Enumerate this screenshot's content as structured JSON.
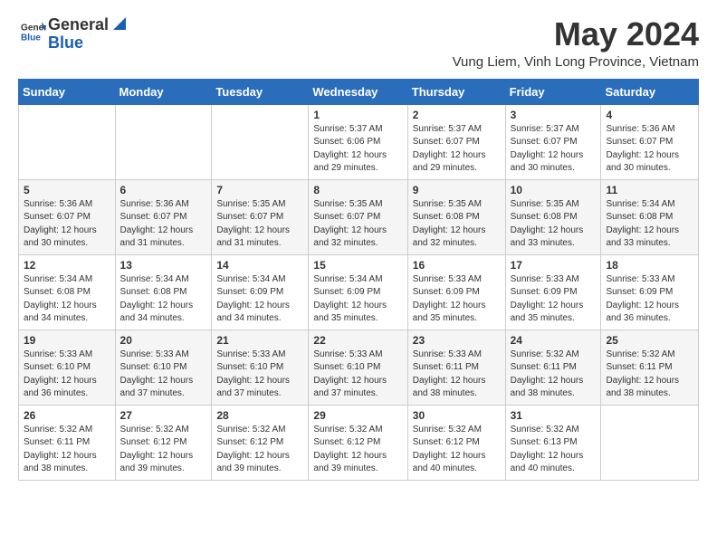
{
  "header": {
    "logo_general": "General",
    "logo_blue": "Blue",
    "month_year": "May 2024",
    "location": "Vung Liem, Vinh Long Province, Vietnam"
  },
  "weekdays": [
    "Sunday",
    "Monday",
    "Tuesday",
    "Wednesday",
    "Thursday",
    "Friday",
    "Saturday"
  ],
  "rows": [
    [
      {
        "day": "",
        "info": ""
      },
      {
        "day": "",
        "info": ""
      },
      {
        "day": "",
        "info": ""
      },
      {
        "day": "1",
        "info": "Sunrise: 5:37 AM\nSunset: 6:06 PM\nDaylight: 12 hours\nand 29 minutes."
      },
      {
        "day": "2",
        "info": "Sunrise: 5:37 AM\nSunset: 6:07 PM\nDaylight: 12 hours\nand 29 minutes."
      },
      {
        "day": "3",
        "info": "Sunrise: 5:37 AM\nSunset: 6:07 PM\nDaylight: 12 hours\nand 30 minutes."
      },
      {
        "day": "4",
        "info": "Sunrise: 5:36 AM\nSunset: 6:07 PM\nDaylight: 12 hours\nand 30 minutes."
      }
    ],
    [
      {
        "day": "5",
        "info": "Sunrise: 5:36 AM\nSunset: 6:07 PM\nDaylight: 12 hours\nand 30 minutes."
      },
      {
        "day": "6",
        "info": "Sunrise: 5:36 AM\nSunset: 6:07 PM\nDaylight: 12 hours\nand 31 minutes."
      },
      {
        "day": "7",
        "info": "Sunrise: 5:35 AM\nSunset: 6:07 PM\nDaylight: 12 hours\nand 31 minutes."
      },
      {
        "day": "8",
        "info": "Sunrise: 5:35 AM\nSunset: 6:07 PM\nDaylight: 12 hours\nand 32 minutes."
      },
      {
        "day": "9",
        "info": "Sunrise: 5:35 AM\nSunset: 6:08 PM\nDaylight: 12 hours\nand 32 minutes."
      },
      {
        "day": "10",
        "info": "Sunrise: 5:35 AM\nSunset: 6:08 PM\nDaylight: 12 hours\nand 33 minutes."
      },
      {
        "day": "11",
        "info": "Sunrise: 5:34 AM\nSunset: 6:08 PM\nDaylight: 12 hours\nand 33 minutes."
      }
    ],
    [
      {
        "day": "12",
        "info": "Sunrise: 5:34 AM\nSunset: 6:08 PM\nDaylight: 12 hours\nand 34 minutes."
      },
      {
        "day": "13",
        "info": "Sunrise: 5:34 AM\nSunset: 6:08 PM\nDaylight: 12 hours\nand 34 minutes."
      },
      {
        "day": "14",
        "info": "Sunrise: 5:34 AM\nSunset: 6:09 PM\nDaylight: 12 hours\nand 34 minutes."
      },
      {
        "day": "15",
        "info": "Sunrise: 5:34 AM\nSunset: 6:09 PM\nDaylight: 12 hours\nand 35 minutes."
      },
      {
        "day": "16",
        "info": "Sunrise: 5:33 AM\nSunset: 6:09 PM\nDaylight: 12 hours\nand 35 minutes."
      },
      {
        "day": "17",
        "info": "Sunrise: 5:33 AM\nSunset: 6:09 PM\nDaylight: 12 hours\nand 35 minutes."
      },
      {
        "day": "18",
        "info": "Sunrise: 5:33 AM\nSunset: 6:09 PM\nDaylight: 12 hours\nand 36 minutes."
      }
    ],
    [
      {
        "day": "19",
        "info": "Sunrise: 5:33 AM\nSunset: 6:10 PM\nDaylight: 12 hours\nand 36 minutes."
      },
      {
        "day": "20",
        "info": "Sunrise: 5:33 AM\nSunset: 6:10 PM\nDaylight: 12 hours\nand 37 minutes."
      },
      {
        "day": "21",
        "info": "Sunrise: 5:33 AM\nSunset: 6:10 PM\nDaylight: 12 hours\nand 37 minutes."
      },
      {
        "day": "22",
        "info": "Sunrise: 5:33 AM\nSunset: 6:10 PM\nDaylight: 12 hours\nand 37 minutes."
      },
      {
        "day": "23",
        "info": "Sunrise: 5:33 AM\nSunset: 6:11 PM\nDaylight: 12 hours\nand 38 minutes."
      },
      {
        "day": "24",
        "info": "Sunrise: 5:32 AM\nSunset: 6:11 PM\nDaylight: 12 hours\nand 38 minutes."
      },
      {
        "day": "25",
        "info": "Sunrise: 5:32 AM\nSunset: 6:11 PM\nDaylight: 12 hours\nand 38 minutes."
      }
    ],
    [
      {
        "day": "26",
        "info": "Sunrise: 5:32 AM\nSunset: 6:11 PM\nDaylight: 12 hours\nand 38 minutes."
      },
      {
        "day": "27",
        "info": "Sunrise: 5:32 AM\nSunset: 6:12 PM\nDaylight: 12 hours\nand 39 minutes."
      },
      {
        "day": "28",
        "info": "Sunrise: 5:32 AM\nSunset: 6:12 PM\nDaylight: 12 hours\nand 39 minutes."
      },
      {
        "day": "29",
        "info": "Sunrise: 5:32 AM\nSunset: 6:12 PM\nDaylight: 12 hours\nand 39 minutes."
      },
      {
        "day": "30",
        "info": "Sunrise: 5:32 AM\nSunset: 6:12 PM\nDaylight: 12 hours\nand 40 minutes."
      },
      {
        "day": "31",
        "info": "Sunrise: 5:32 AM\nSunset: 6:13 PM\nDaylight: 12 hours\nand 40 minutes."
      },
      {
        "day": "",
        "info": ""
      }
    ]
  ]
}
